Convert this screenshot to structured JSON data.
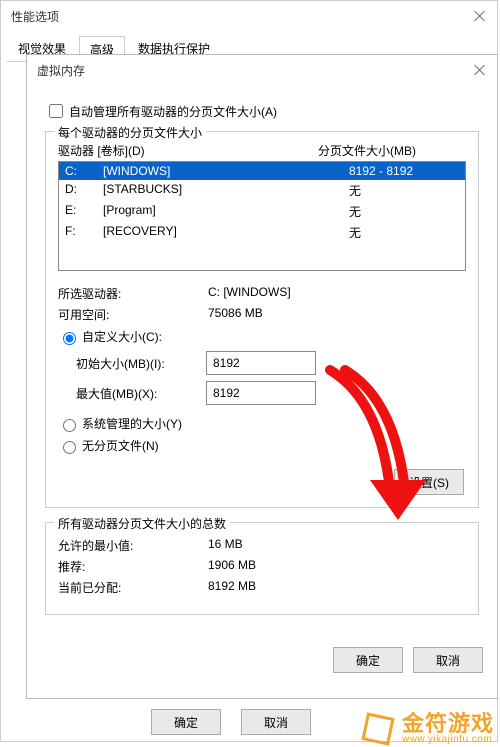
{
  "outer": {
    "title": "性能选项",
    "tabs": [
      "视觉效果",
      "高级",
      "数据执行保护"
    ],
    "active_tab": 1,
    "ok": "确定",
    "cancel": "取消"
  },
  "vm": {
    "title": "虚拟内存",
    "auto_checkbox": "自动管理所有驱动器的分页文件大小(A)",
    "group1_legend": "每个驱动器的分页文件大小",
    "col_drive": "驱动器 [卷标](D)",
    "col_size": "分页文件大小(MB)",
    "drives": [
      {
        "letter": "C:",
        "label": "[WINDOWS]",
        "size": "8192 - 8192",
        "selected": true
      },
      {
        "letter": "D:",
        "label": "[STARBUCKS]",
        "size": "无",
        "selected": false
      },
      {
        "letter": "E:",
        "label": "[Program]",
        "size": "无",
        "selected": false
      },
      {
        "letter": "F:",
        "label": "[RECOVERY]",
        "size": "无",
        "selected": false
      }
    ],
    "selected_drive_label": "所选驱动器:",
    "selected_drive_value": "C: [WINDOWS]",
    "free_space_label": "可用空间:",
    "free_space_value": "75086 MB",
    "radio_custom": "自定义大小(C):",
    "initial_label": "初始大小(MB)(I):",
    "initial_value": "8192",
    "max_label": "最大值(MB)(X):",
    "max_value": "8192",
    "radio_system": "系统管理的大小(Y)",
    "radio_none": "无分页文件(N)",
    "set_button": "设置(S)",
    "group2_legend": "所有驱动器分页文件大小的总数",
    "min_label": "允许的最小值:",
    "min_value": "16 MB",
    "rec_label": "推荐:",
    "rec_value": "1906 MB",
    "cur_label": "当前已分配:",
    "cur_value": "8192 MB",
    "ok": "确定",
    "cancel": "取消"
  },
  "watermark": {
    "cn": "金符游戏",
    "en": "www.yikajinfu.com"
  }
}
